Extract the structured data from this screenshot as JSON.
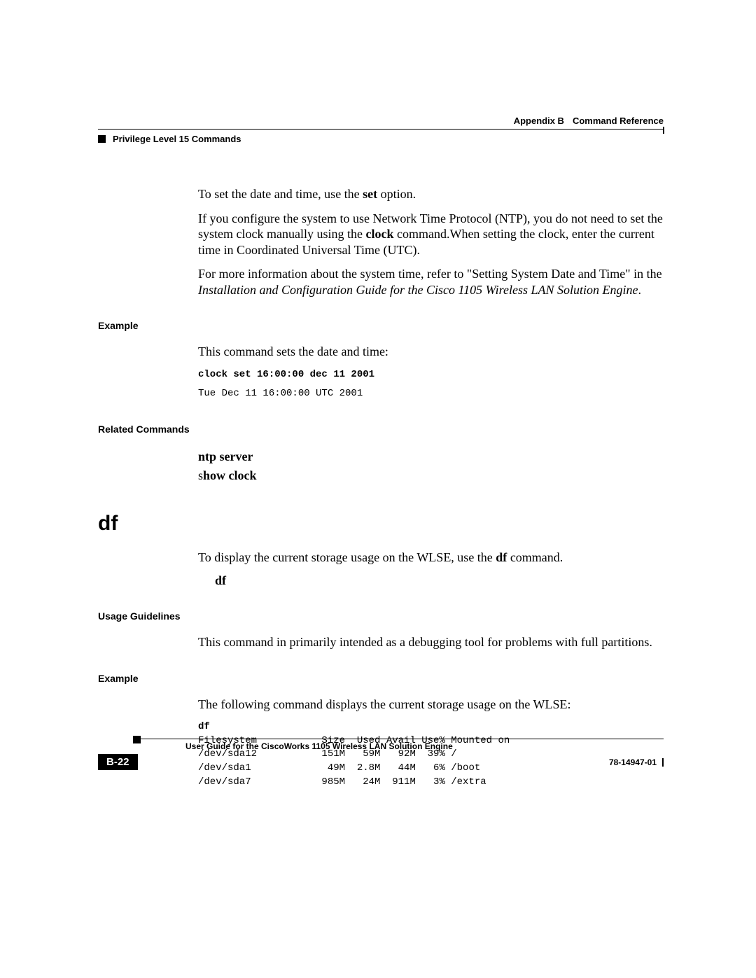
{
  "header": {
    "appendix": "Appendix B",
    "title": "Command Reference",
    "section": "Privilege Level 15 Commands"
  },
  "body": {
    "p1_pre": "To set the date and time, use the ",
    "p1_bold": "set",
    "p1_post": " option.",
    "p2_pre": "If you configure the system to use Network Time Protocol (NTP), you do not need to set the system clock manually using the ",
    "p2_bold": "clock",
    "p2_post": " command.When setting the clock, enter the current time in Coordinated Universal Time (UTC).",
    "p3_pre": "For more information about the system time, refer to \"Setting System Date and Time\" in the ",
    "p3_italic": "Installation and Configuration Guide for the Cisco 1105 Wireless LAN Solution Engine",
    "p3_post": ".",
    "example_label": "Example",
    "example_intro": "This command sets the date and time:",
    "example_cmd": "clock set 16:00:00 dec 11 2001",
    "example_out": "Tue Dec 11 16:00:00 UTC 2001",
    "related_label": "Related Commands",
    "related_1": "ntp server",
    "related_2_pre": "s",
    "related_2_bold": "how clock",
    "df_heading": "df",
    "df_p1_pre": "To display the current storage usage on the WLSE, use the ",
    "df_p1_bold": "df",
    "df_p1_post": " command.",
    "df_syntax": "df",
    "usage_label": "Usage Guidelines",
    "usage_text": "This command in primarily intended as a debugging tool for problems with full partitions.",
    "example2_label": "Example",
    "example2_intro": "The following command displays the current storage usage on the WLSE:",
    "df_cmd": "df",
    "df_out": "Filesystem           Size  Used Avail Use% Mounted on\n/dev/sda12           151M   59M   92M  39% /\n/dev/sda1             49M  2.8M   44M   6% /boot\n/dev/sda7            985M   24M  911M   3% /extra"
  },
  "footer": {
    "guide_title": "User Guide for the CiscoWorks 1105 Wireless LAN Solution Engine",
    "page_number": "B-22",
    "doc_number": "78-14947-01"
  }
}
